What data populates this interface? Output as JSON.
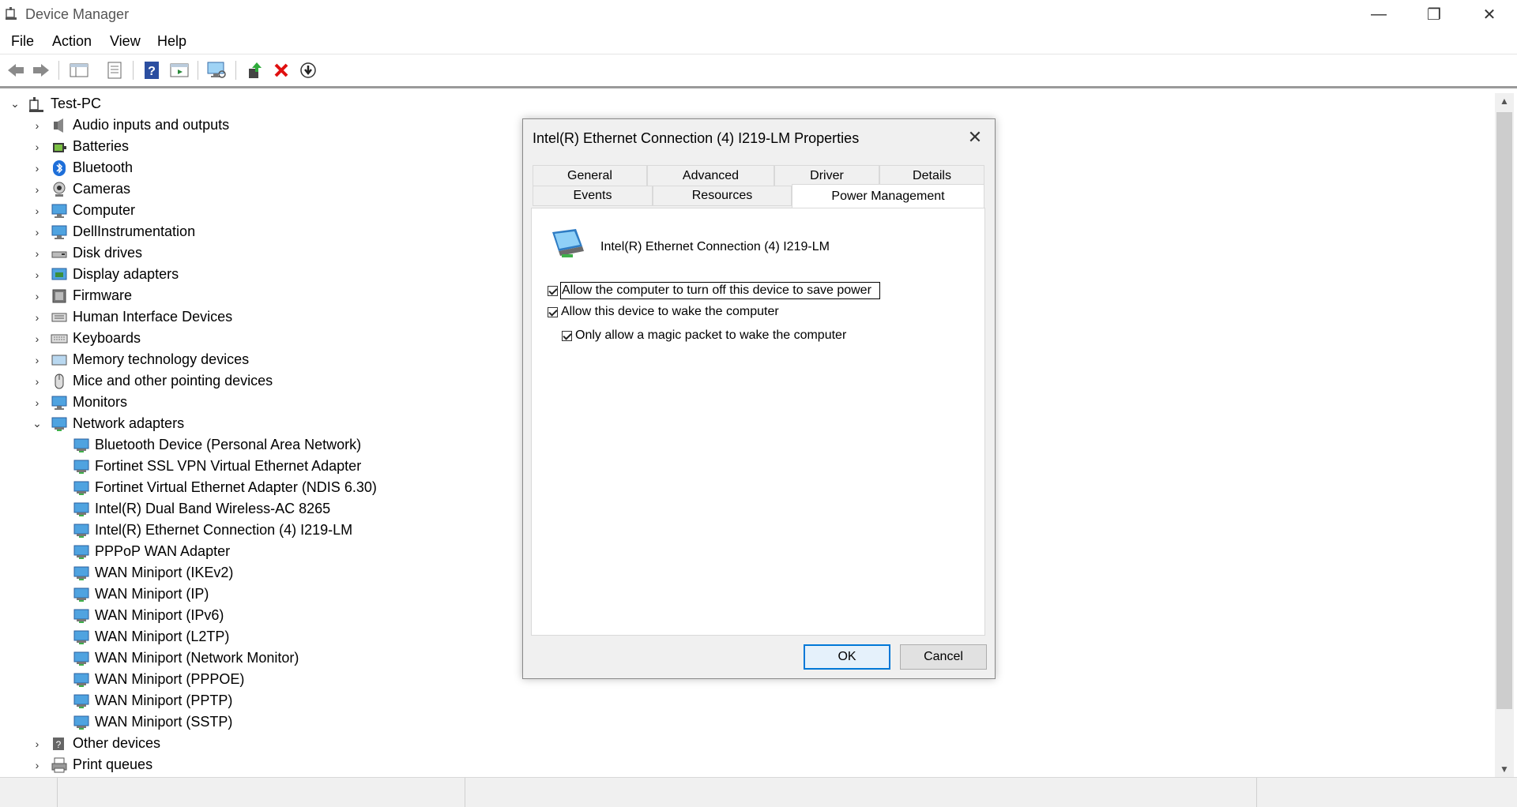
{
  "window": {
    "title": "Device Manager",
    "minimize_glyph": "—",
    "maximize_glyph": "❐",
    "close_glyph": "✕"
  },
  "menu": {
    "file": "File",
    "action": "Action",
    "view": "View",
    "help": "Help"
  },
  "toolbar": {
    "icons": [
      "back-icon",
      "forward-icon",
      "show-hide-tree-icon",
      "properties-icon",
      "help-icon",
      "action-pane-icon",
      "scan-hardware-icon",
      "update-driver-icon",
      "uninstall-device-icon",
      "disable-device-icon"
    ]
  },
  "tree": {
    "root": "Test-PC",
    "categories": [
      {
        "label": "Audio inputs and outputs",
        "icon": "speaker-icon"
      },
      {
        "label": "Batteries",
        "icon": "battery-icon"
      },
      {
        "label": "Bluetooth",
        "icon": "bluetooth-icon"
      },
      {
        "label": "Cameras",
        "icon": "camera-icon"
      },
      {
        "label": "Computer",
        "icon": "computer-icon"
      },
      {
        "label": "DellInstrumentation",
        "icon": "monitor-icon"
      },
      {
        "label": "Disk drives",
        "icon": "disk-drive-icon"
      },
      {
        "label": "Display adapters",
        "icon": "display-adapter-icon"
      },
      {
        "label": "Firmware",
        "icon": "firmware-icon"
      },
      {
        "label": "Human Interface Devices",
        "icon": "hid-icon"
      },
      {
        "label": "Keyboards",
        "icon": "keyboard-icon"
      },
      {
        "label": "Memory technology devices",
        "icon": "memory-icon"
      },
      {
        "label": "Mice and other pointing devices",
        "icon": "mouse-icon"
      },
      {
        "label": "Monitors",
        "icon": "monitor-icon"
      },
      {
        "label": "Network adapters",
        "icon": "network-adapter-icon"
      }
    ],
    "network_adapters": [
      "Bluetooth Device (Personal Area Network)",
      "Fortinet SSL VPN Virtual Ethernet Adapter",
      "Fortinet Virtual Ethernet Adapter (NDIS 6.30)",
      "Intel(R) Dual Band Wireless-AC 8265",
      "Intel(R) Ethernet Connection (4) I219-LM",
      "PPPoP WAN Adapter",
      "WAN Miniport (IKEv2)",
      "WAN Miniport (IP)",
      "WAN Miniport (IPv6)",
      "WAN Miniport (L2TP)",
      "WAN Miniport (Network Monitor)",
      "WAN Miniport (PPPOE)",
      "WAN Miniport (PPTP)",
      "WAN Miniport (SSTP)"
    ],
    "after": [
      {
        "label": "Other devices",
        "icon": "other-devices-icon"
      },
      {
        "label": "Print queues",
        "icon": "printer-icon"
      }
    ]
  },
  "dialog": {
    "title": "Intel(R) Ethernet Connection (4) I219-LM Properties",
    "tabs": {
      "general": "General",
      "advanced": "Advanced",
      "driver": "Driver",
      "details": "Details",
      "events": "Events",
      "resources": "Resources",
      "power_management": "Power Management"
    },
    "device_name": "Intel(R) Ethernet Connection (4) I219-LM",
    "options": {
      "allow_turn_off": "Allow the computer to turn off this device to save power",
      "allow_wake": "Allow this device to wake the computer",
      "magic_packet": "Only allow a magic packet to wake the computer"
    },
    "ok": "OK",
    "cancel": "Cancel"
  }
}
